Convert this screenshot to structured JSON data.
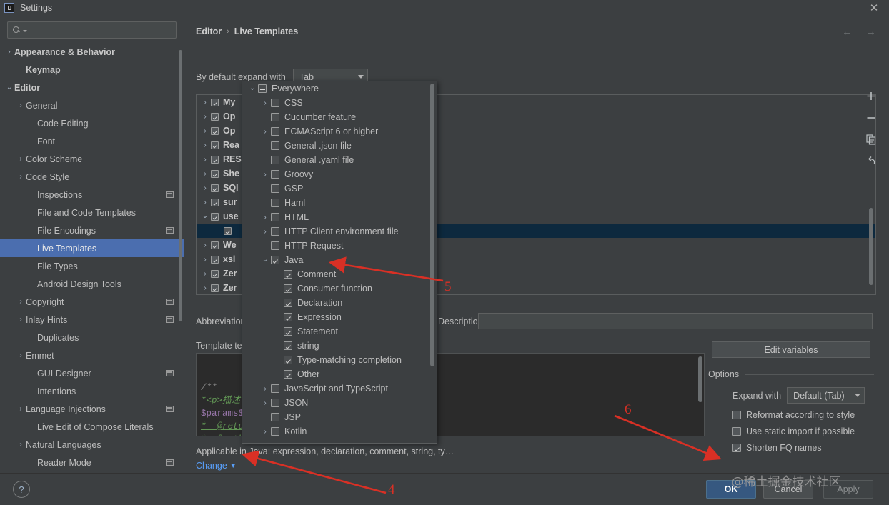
{
  "window": {
    "title": "Settings",
    "logo_text": "IJ",
    "close_icon": "close-icon"
  },
  "sidebar": {
    "search": {
      "value": "",
      "placeholder": ""
    },
    "items": [
      {
        "label": "Appearance & Behavior",
        "arrow": "›",
        "indent": 0,
        "bold": true,
        "badge": false,
        "selected": false
      },
      {
        "label": "Keymap",
        "arrow": "",
        "indent": 1,
        "bold": true,
        "badge": false,
        "selected": false
      },
      {
        "label": "Editor",
        "arrow": "⌄",
        "indent": 0,
        "bold": true,
        "badge": false,
        "selected": false
      },
      {
        "label": "General",
        "arrow": "›",
        "indent": 1,
        "bold": false,
        "badge": false,
        "selected": false
      },
      {
        "label": "Code Editing",
        "arrow": "",
        "indent": 2,
        "bold": false,
        "badge": false,
        "selected": false
      },
      {
        "label": "Font",
        "arrow": "",
        "indent": 2,
        "bold": false,
        "badge": false,
        "selected": false
      },
      {
        "label": "Color Scheme",
        "arrow": "›",
        "indent": 1,
        "bold": false,
        "badge": false,
        "selected": false
      },
      {
        "label": "Code Style",
        "arrow": "›",
        "indent": 1,
        "bold": false,
        "badge": false,
        "selected": false
      },
      {
        "label": "Inspections",
        "arrow": "",
        "indent": 2,
        "bold": false,
        "badge": true,
        "selected": false
      },
      {
        "label": "File and Code Templates",
        "arrow": "",
        "indent": 2,
        "bold": false,
        "badge": false,
        "selected": false
      },
      {
        "label": "File Encodings",
        "arrow": "",
        "indent": 2,
        "bold": false,
        "badge": true,
        "selected": false
      },
      {
        "label": "Live Templates",
        "arrow": "",
        "indent": 2,
        "bold": false,
        "badge": false,
        "selected": true
      },
      {
        "label": "File Types",
        "arrow": "",
        "indent": 2,
        "bold": false,
        "badge": false,
        "selected": false
      },
      {
        "label": "Android Design Tools",
        "arrow": "",
        "indent": 2,
        "bold": false,
        "badge": false,
        "selected": false
      },
      {
        "label": "Copyright",
        "arrow": "›",
        "indent": 1,
        "bold": false,
        "badge": true,
        "selected": false
      },
      {
        "label": "Inlay Hints",
        "arrow": "›",
        "indent": 1,
        "bold": false,
        "badge": true,
        "selected": false
      },
      {
        "label": "Duplicates",
        "arrow": "",
        "indent": 2,
        "bold": false,
        "badge": false,
        "selected": false
      },
      {
        "label": "Emmet",
        "arrow": "›",
        "indent": 1,
        "bold": false,
        "badge": false,
        "selected": false
      },
      {
        "label": "GUI Designer",
        "arrow": "",
        "indent": 2,
        "bold": false,
        "badge": true,
        "selected": false
      },
      {
        "label": "Intentions",
        "arrow": "",
        "indent": 2,
        "bold": false,
        "badge": false,
        "selected": false
      },
      {
        "label": "Language Injections",
        "arrow": "›",
        "indent": 1,
        "bold": false,
        "badge": true,
        "selected": false
      },
      {
        "label": "Live Edit of Compose Literals",
        "arrow": "",
        "indent": 2,
        "bold": false,
        "badge": false,
        "selected": false
      },
      {
        "label": "Natural Languages",
        "arrow": "›",
        "indent": 1,
        "bold": false,
        "badge": false,
        "selected": false
      },
      {
        "label": "Reader Mode",
        "arrow": "",
        "indent": 2,
        "bold": false,
        "badge": true,
        "selected": false
      }
    ]
  },
  "main": {
    "breadcrumb": {
      "parent": "Editor",
      "separator": "›",
      "current": "Live Templates"
    },
    "nav": {
      "back_icon": "arrow-left-icon",
      "forward_icon": "arrow-right-icon"
    },
    "expand_row": {
      "label": "By default expand with",
      "value": "Tab"
    },
    "template_tree": [
      {
        "label": "My",
        "arrow": "›",
        "checked": true,
        "indent": 0,
        "selected": false
      },
      {
        "label": "Op",
        "arrow": "›",
        "checked": true,
        "indent": 0,
        "selected": false
      },
      {
        "label": "Op",
        "arrow": "›",
        "checked": true,
        "indent": 0,
        "selected": false
      },
      {
        "label": "Rea",
        "arrow": "›",
        "checked": true,
        "indent": 0,
        "selected": false
      },
      {
        "label": "RES",
        "arrow": "›",
        "checked": true,
        "indent": 0,
        "selected": false
      },
      {
        "label": "She",
        "arrow": "›",
        "checked": true,
        "indent": 0,
        "selected": false
      },
      {
        "label": "SQl",
        "arrow": "›",
        "checked": true,
        "indent": 0,
        "selected": false
      },
      {
        "label": "sur",
        "arrow": "›",
        "checked": true,
        "indent": 0,
        "selected": false
      },
      {
        "label": "use",
        "arrow": "⌄",
        "checked": true,
        "indent": 0,
        "selected": false
      },
      {
        "label": "",
        "arrow": "",
        "checked": true,
        "indent": 1,
        "selected": true
      },
      {
        "label": "We",
        "arrow": "›",
        "checked": true,
        "indent": 0,
        "selected": false
      },
      {
        "label": "xsl",
        "arrow": "›",
        "checked": true,
        "indent": 0,
        "selected": false
      },
      {
        "label": "Zer",
        "arrow": "›",
        "checked": true,
        "indent": 0,
        "selected": false
      },
      {
        "label": "Zer",
        "arrow": "›",
        "checked": true,
        "indent": 0,
        "selected": false
      }
    ],
    "toolbar": [
      {
        "name": "add-icon",
        "tooltip": "Add"
      },
      {
        "name": "remove-icon",
        "tooltip": "Remove"
      },
      {
        "name": "copy-icon",
        "tooltip": "Duplicate"
      },
      {
        "name": "revert-icon",
        "tooltip": "Revert"
      }
    ],
    "abbreviation_label": "Abbreviation:",
    "description_label": "Description:",
    "description_value": "",
    "template_text_label": "Template text:",
    "template_code_lines": [
      {
        "text": "/**",
        "cls": "c-gray"
      },
      {
        "text": "*<p>描述",
        "cls": "c-green"
      },
      {
        "text": "$params$",
        "cls": "c-purple"
      },
      {
        "text": "*  @retur",
        "cls": "c-tag"
      },
      {
        "text": "*  @autho",
        "cls": "c-tag"
      }
    ],
    "applicable_text": "Applicable in Java: expression, declaration, comment, string, ty…",
    "change_link": "Change",
    "edit_variables": "Edit variables",
    "options": {
      "title": "Options",
      "expand_with_label": "Expand with",
      "expand_with_value": "Default (Tab)",
      "checkboxes": [
        {
          "label": "Reformat according to style",
          "checked": false
        },
        {
          "label": "Use static import if possible",
          "checked": false
        },
        {
          "label": "Shorten FQ names",
          "checked": true
        }
      ]
    }
  },
  "popup": {
    "items": [
      {
        "label": "Everywhere",
        "arrow": "⌄",
        "state": "dash",
        "indent": 0
      },
      {
        "label": "CSS",
        "arrow": "›",
        "state": "unchecked",
        "indent": 1
      },
      {
        "label": "Cucumber feature",
        "arrow": "",
        "state": "unchecked",
        "indent": 1
      },
      {
        "label": "ECMAScript 6 or higher",
        "arrow": "›",
        "state": "unchecked",
        "indent": 1
      },
      {
        "label": "General .json file",
        "arrow": "",
        "state": "unchecked",
        "indent": 1
      },
      {
        "label": "General .yaml file",
        "arrow": "",
        "state": "unchecked",
        "indent": 1
      },
      {
        "label": "Groovy",
        "arrow": "›",
        "state": "unchecked",
        "indent": 1
      },
      {
        "label": "GSP",
        "arrow": "",
        "state": "unchecked",
        "indent": 1
      },
      {
        "label": "Haml",
        "arrow": "",
        "state": "unchecked",
        "indent": 1
      },
      {
        "label": "HTML",
        "arrow": "›",
        "state": "unchecked",
        "indent": 1
      },
      {
        "label": "HTTP Client environment file",
        "arrow": "›",
        "state": "unchecked",
        "indent": 1
      },
      {
        "label": "HTTP Request",
        "arrow": "",
        "state": "unchecked",
        "indent": 1
      },
      {
        "label": "Java",
        "arrow": "⌄",
        "state": "checked",
        "indent": 1
      },
      {
        "label": "Comment",
        "arrow": "",
        "state": "checked",
        "indent": 2
      },
      {
        "label": "Consumer function",
        "arrow": "",
        "state": "checked",
        "indent": 2
      },
      {
        "label": "Declaration",
        "arrow": "",
        "state": "checked",
        "indent": 2
      },
      {
        "label": "Expression",
        "arrow": "",
        "state": "checked",
        "indent": 2
      },
      {
        "label": "Statement",
        "arrow": "",
        "state": "checked",
        "indent": 2
      },
      {
        "label": "string",
        "arrow": "",
        "state": "checked",
        "indent": 2
      },
      {
        "label": "Type-matching completion",
        "arrow": "",
        "state": "checked",
        "indent": 2
      },
      {
        "label": "Other",
        "arrow": "",
        "state": "checked",
        "indent": 2
      },
      {
        "label": "JavaScript and TypeScript",
        "arrow": "›",
        "state": "unchecked",
        "indent": 1
      },
      {
        "label": "JSON",
        "arrow": "›",
        "state": "unchecked",
        "indent": 1
      },
      {
        "label": "JSP",
        "arrow": "",
        "state": "unchecked",
        "indent": 1
      },
      {
        "label": "Kotlin",
        "arrow": "›",
        "state": "unchecked",
        "indent": 1
      }
    ]
  },
  "footer": {
    "help_label": "?",
    "ok": "OK",
    "cancel": "Cancel",
    "apply": "Apply",
    "watermark": "@稀土掘金技术社区"
  },
  "annotations": {
    "accent_color": "#d93025",
    "markers": [
      {
        "number": "4"
      },
      {
        "number": "5"
      },
      {
        "number": "6"
      }
    ]
  }
}
